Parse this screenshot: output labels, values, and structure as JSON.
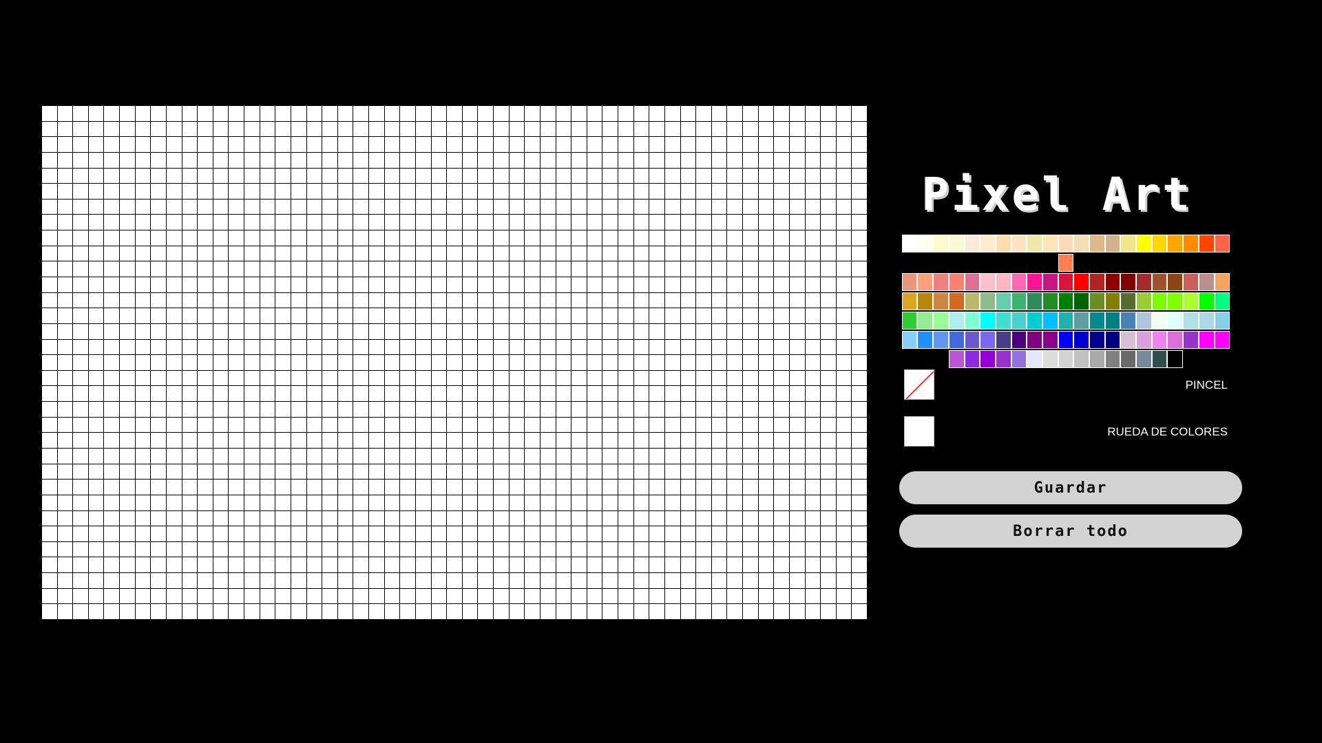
{
  "app": {
    "title": "Pixel Art"
  },
  "canvas": {
    "columns": 53,
    "rows": 33,
    "pixel_color": "#ffffff",
    "grid_line_color": "#000000"
  },
  "palette": {
    "rows": [
      [
        "#ffffff",
        "#fffff0",
        "#fffacd",
        "#fafad2",
        "#faebd7",
        "#ffebcd",
        "#ffdead",
        "#ffe4c4",
        "#eee8aa",
        "#ffe4b5",
        "#ffdab9",
        "#f5deb3",
        "#deb887",
        "#d2b48c",
        "#f0e68c",
        "#ffff00",
        "#ffd700",
        "#ffa500",
        "#ff8c00",
        "#ff4500",
        "#ff6347",
        "#ff7f50"
      ],
      [
        "#e9967a",
        "#ffa07a",
        "#f08080",
        "#fa8072",
        "#db7093",
        "#ffc0cb",
        "#ffb6c1",
        "#ff69b4",
        "#ff1493",
        "#c71585",
        "#dc143c",
        "#ff0000",
        "#b22222",
        "#8b0000",
        "#800000",
        "#a52a2a",
        "#a0522d",
        "#8b4513",
        "#cd5c5c",
        "#bc8f8f",
        "#f4a460"
      ],
      [
        "#daa520",
        "#b8860b",
        "#cd853f",
        "#d2691e",
        "#bdb76b",
        "#8fbc8f",
        "#66cdaa",
        "#3cb371",
        "#2e8b57",
        "#228b22",
        "#008000",
        "#006400",
        "#6b8e23",
        "#808000",
        "#556b2f",
        "#9acd32",
        "#7cfc00",
        "#7fff00",
        "#adff2f",
        "#00ff00",
        "#00ff7f"
      ],
      [
        "#32cd32",
        "#90ee90",
        "#98fb98",
        "#afeeee",
        "#7fffd4",
        "#00ffff",
        "#40e0d0",
        "#48d1cc",
        "#00ced1",
        "#00bfff",
        "#20b2aa",
        "#5f9ea0",
        "#008b8b",
        "#008080",
        "#4682b4",
        "#b0c4de",
        "#f0fff0",
        "#e0ffff",
        "#b0e0e6",
        "#add8e6",
        "#87ceeb"
      ],
      [
        "#87cefa",
        "#1e90ff",
        "#6495ed",
        "#4169e1",
        "#6a5acd",
        "#7b68ee",
        "#483d8b",
        "#4b0082",
        "#800080",
        "#8b008b",
        "#0000ff",
        "#0000cd",
        "#00008b",
        "#000080",
        "#d8bfd8",
        "#dda0dd",
        "#ee82ee",
        "#da70d6",
        "#9932cc",
        "#ff00ff",
        "#ff00ff"
      ],
      [
        "#ba55d3",
        "#8a2be2",
        "#9400d3",
        "#9932cc",
        "#9370db",
        "#e6e6fa",
        "#dcdcdc",
        "#d3d3d3",
        "#c0c0c0",
        "#a9a9a9",
        "#808080",
        "#696969",
        "#778899",
        "#2f4f4f",
        "#000000"
      ]
    ]
  },
  "tools": {
    "pencil": {
      "label": "PINCEL",
      "icon": "no-color-slash-icon"
    },
    "color_wheel": {
      "label": "RUEDA DE COLORES",
      "value": "#ffffff"
    }
  },
  "actions": {
    "save_label": "Guardar",
    "clear_label": "Borrar todo"
  }
}
